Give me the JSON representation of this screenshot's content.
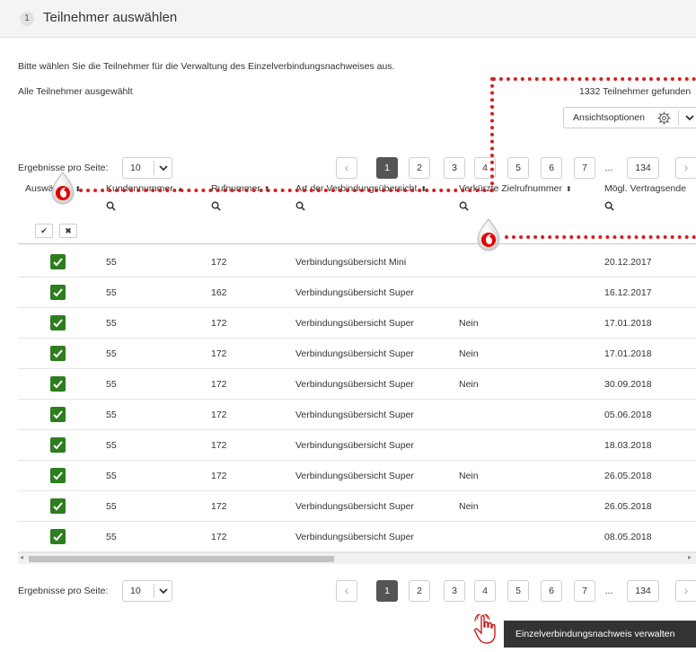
{
  "header": {
    "step_number": "1",
    "title": "Teilnehmer auswählen"
  },
  "intro_text": "Bitte wählen Sie die Teilnehmer für die Verwaltung des Einzelverbindungsnachweises aus.",
  "selection_status": "Alle Teilnehmer ausgewählt",
  "results_count": "1332 Teilnehmer gefunden",
  "view_options": {
    "label": "Ansichtsoptionen",
    "icon": "gear-icon"
  },
  "per_page": {
    "label": "Ergebnisse pro Seite:",
    "value": "10"
  },
  "pagination": {
    "pages": [
      "1",
      "2",
      "3",
      "4",
      "5",
      "6",
      "7"
    ],
    "ellipsis": "...",
    "last": "134",
    "current": "1",
    "prev": "‹",
    "next": "›"
  },
  "table": {
    "columns": [
      "Auswählen",
      "Kundennummer",
      "Rufnummer",
      "Art der Verbindungsübersicht",
      "Verkürzte Zielrufnummer",
      "Mögl. Vertragsende"
    ],
    "select_all_label": "✔",
    "deselect_all_label": "✖",
    "rows": [
      {
        "kundennummer": "55",
        "rufnummer": "172",
        "art": "Verbindungsübersicht Mini",
        "verkuerzt": "",
        "vertragsende": "20.12.2017"
      },
      {
        "kundennummer": "55",
        "rufnummer": "162",
        "art": "Verbindungsübersicht Super",
        "verkuerzt": "",
        "vertragsende": "16.12.2017"
      },
      {
        "kundennummer": "55",
        "rufnummer": "172",
        "art": "Verbindungsübersicht Super",
        "verkuerzt": "Nein",
        "vertragsende": "17.01.2018"
      },
      {
        "kundennummer": "55",
        "rufnummer": "172",
        "art": "Verbindungsübersicht Super",
        "verkuerzt": "Nein",
        "vertragsende": "17.01.2018"
      },
      {
        "kundennummer": "55",
        "rufnummer": "172",
        "art": "Verbindungsübersicht Super",
        "verkuerzt": "Nein",
        "vertragsende": "30.09.2018"
      },
      {
        "kundennummer": "55",
        "rufnummer": "172",
        "art": "Verbindungsübersicht Super",
        "verkuerzt": "",
        "vertragsende": "05.06.2018"
      },
      {
        "kundennummer": "55",
        "rufnummer": "172",
        "art": "Verbindungsübersicht Super",
        "verkuerzt": "",
        "vertragsende": "18.03.2018"
      },
      {
        "kundennummer": "55",
        "rufnummer": "172",
        "art": "Verbindungsübersicht Super",
        "verkuerzt": "Nein",
        "vertragsende": "26.05.2018"
      },
      {
        "kundennummer": "55",
        "rufnummer": "172",
        "art": "Verbindungsübersicht Super",
        "verkuerzt": "Nein",
        "vertragsende": "26.05.2018"
      },
      {
        "kundennummer": "55",
        "rufnummer": "172",
        "art": "Verbindungsübersicht Super",
        "verkuerzt": "",
        "vertragsende": "08.05.2018"
      }
    ]
  },
  "action_button": "Einzelverbindungsnachweis verwalten",
  "colors": {
    "checkbox_green": "#2e7d1e",
    "active_page": "#555555",
    "annotation_red": "#d61f1f",
    "button_dark": "#333333"
  }
}
